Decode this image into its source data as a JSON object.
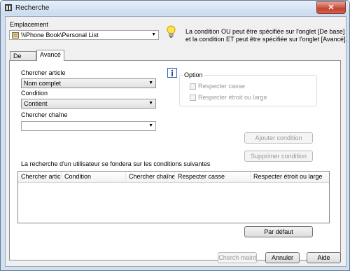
{
  "window": {
    "title": "Recherche",
    "close_label": "✕"
  },
  "location": {
    "label": "Emplacement",
    "value": "\\\\iPhone Book\\Personal List"
  },
  "hint": {
    "line1": "La condition OU peut être spécifiée sur l'onglet [De base]",
    "line2": "et la condition ET peut être spécifiée sur l'onglet [Avancé]."
  },
  "tabs": [
    {
      "label": "De base"
    },
    {
      "label": "Avancé"
    }
  ],
  "advanced": {
    "field_label": "Chercher article",
    "field_value": "Nom complet",
    "condition_label": "Condition",
    "condition_value": "Contient",
    "search_string_label": "Chercher chaîne",
    "search_string_value": "",
    "option_title": "Option",
    "match_case_label": "Respecter casse",
    "match_width_label": "Respecter étroit ou large",
    "add_condition_label": "Ajouter condition",
    "remove_condition_label": "Supprimer condition",
    "conditions_caption": "La recherche d'un utilisateur se fondera sur les conditions suivantes",
    "columns": [
      "Chercher article",
      "Condition",
      "Chercher chaîne",
      "Respecter casse",
      "Respecter étroit ou large"
    ],
    "rows": [],
    "default_label": "Par défaut"
  },
  "footer": {
    "search_now_label": "Cherch maint",
    "cancel_label": "Annuler",
    "help_label": "Aide"
  }
}
